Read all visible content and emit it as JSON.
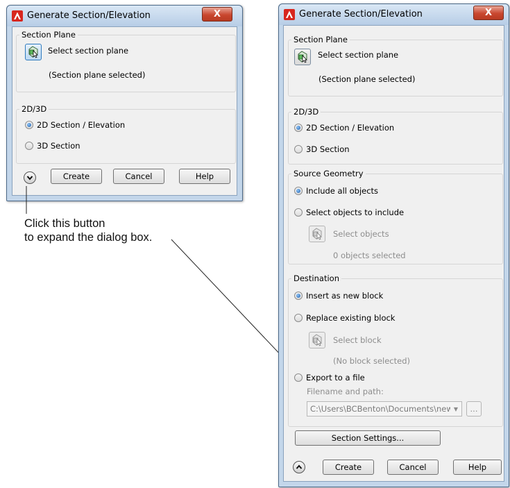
{
  "dialog_title": "Generate Section/Elevation",
  "close_symbol": "X",
  "colors": {
    "accent": "#2f7bbf",
    "titlebar": "#c3d6ea",
    "close": "#c9472f",
    "icon_red": "#d7261e"
  },
  "section_plane": {
    "legend": "Section Plane",
    "select_label": "Select section plane",
    "status": "(Section plane selected)"
  },
  "mode": {
    "legend": "2D/3D",
    "options": [
      "2D Section / Elevation",
      "3D Section"
    ],
    "selected": "2D Section / Elevation"
  },
  "source_geometry": {
    "legend": "Source Geometry",
    "options": [
      "Include all objects",
      "Select objects to include"
    ],
    "selected": "Include all objects",
    "select_label": "Select objects",
    "status": "0 objects selected"
  },
  "destination": {
    "legend": "Destination",
    "options": [
      "Insert as new block",
      "Replace existing block",
      "Export to a file"
    ],
    "selected": "Insert as new block",
    "select_label": "Select block",
    "status": "(No block selected)",
    "filename_label": "Filename and path:",
    "filename_value": "C:\\Users\\BCBenton\\Documents\\new",
    "browse_label": "..."
  },
  "buttons": {
    "create": "Create",
    "cancel": "Cancel",
    "help": "Help",
    "section_settings": "Section Settings..."
  },
  "icons": {
    "app": "autocad-logo-icon",
    "select": "select-cursor-icon",
    "expand": "chevron-down-icon",
    "collapse": "chevron-up-icon"
  },
  "callout": {
    "line1": "Click this button",
    "line2": "to expand the dialog box."
  }
}
